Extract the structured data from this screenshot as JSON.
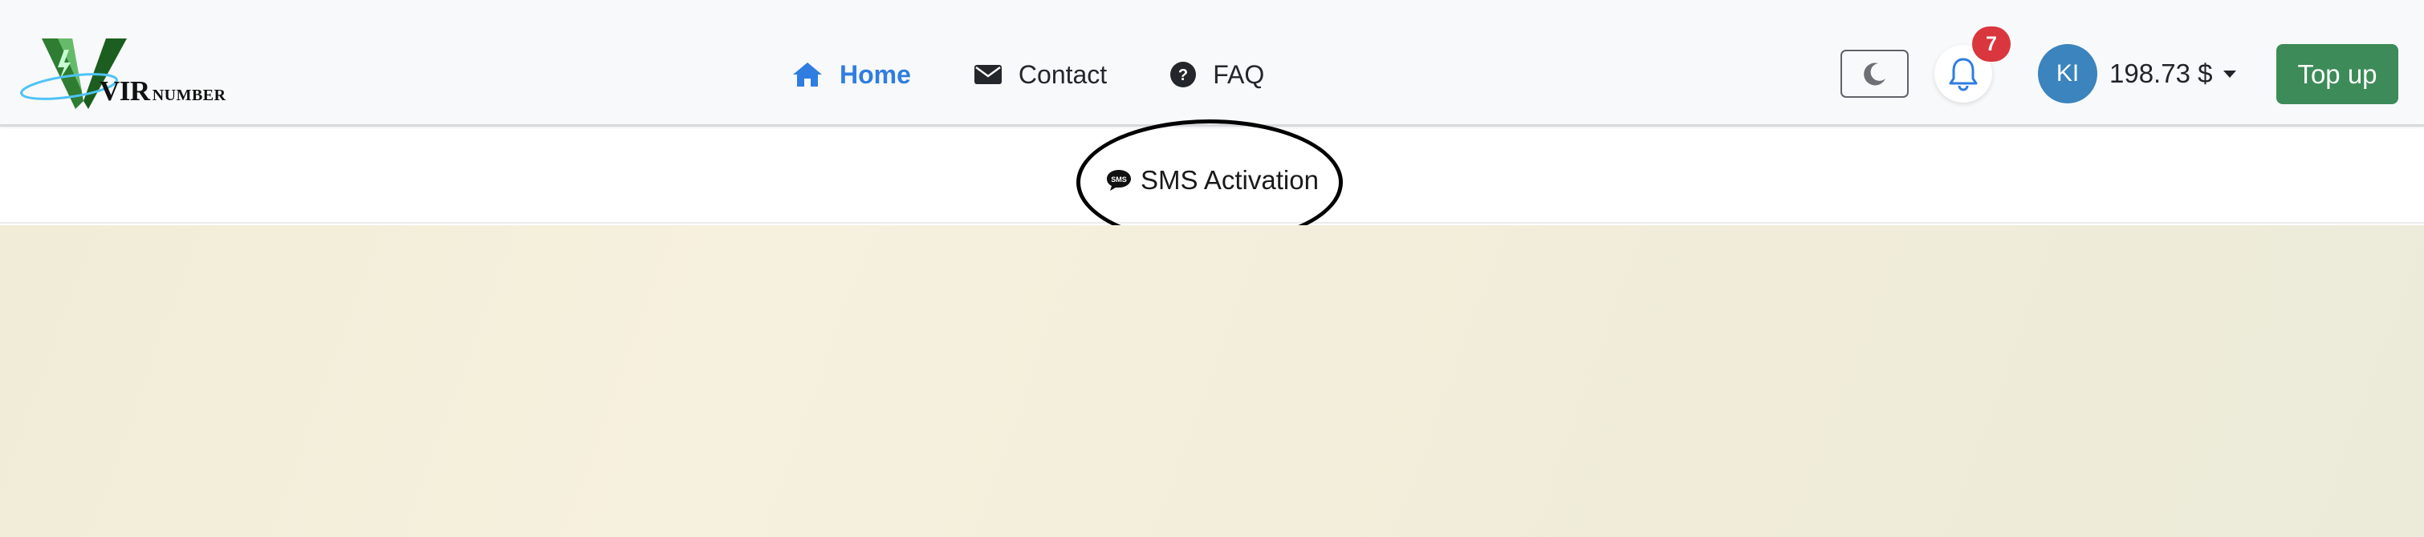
{
  "brand": {
    "logo_main": "VIR",
    "logo_sub": "NUMBER"
  },
  "nav": {
    "items": [
      {
        "label": "Home",
        "icon": "home-icon",
        "active": true
      },
      {
        "label": "Contact",
        "icon": "envelope-icon",
        "active": false
      },
      {
        "label": "FAQ",
        "icon": "question-circle-icon",
        "active": false
      }
    ]
  },
  "header": {
    "notification_count": "7",
    "avatar_initials": "KI",
    "balance": "198.73 $",
    "topup_label": "Top up"
  },
  "subnav": {
    "sms_label": "SMS Activation",
    "sms_icon_text": "SMS"
  },
  "colors": {
    "nav_active": "#2f7de1",
    "badge": "#d9363e",
    "avatar": "#3b84bd",
    "topup": "#3d8b58",
    "navbar_bg": "#f8f9fa",
    "content_bg": "#f0ecd7"
  }
}
